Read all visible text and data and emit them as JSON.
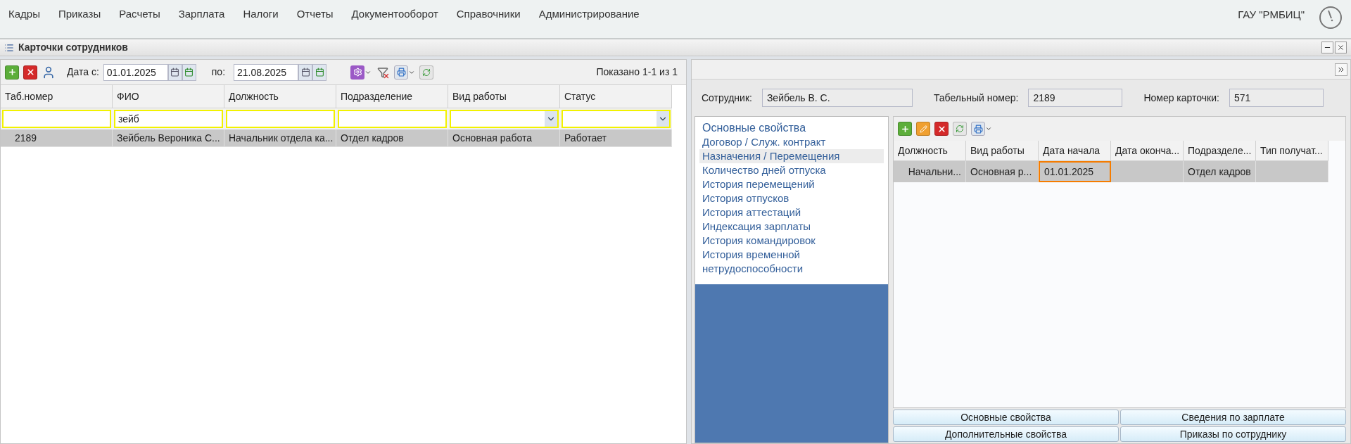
{
  "menu": {
    "items": [
      "Кадры",
      "Приказы",
      "Расчеты",
      "Зарплата",
      "Налоги",
      "Отчеты",
      "Документооборот",
      "Справочники",
      "Администрирование"
    ],
    "org": "ГАУ \"РМБИЦ\""
  },
  "window": {
    "title": "Карточки сотрудников"
  },
  "toolbar": {
    "date_from_label": "Дата с:",
    "date_from": "01.01.2025",
    "date_to_label": "по:",
    "date_to": "21.08.2025",
    "shown": "Показано 1-1 из 1"
  },
  "table": {
    "columns": [
      {
        "label": "Таб.номер",
        "filter": {
          "kind": "text"
        }
      },
      {
        "label": "ФИО",
        "filter": {
          "kind": "text",
          "value": "зейб"
        }
      },
      {
        "label": "Должность",
        "filter": {
          "kind": "text"
        }
      },
      {
        "label": "Подразделение",
        "filter": {
          "kind": "text"
        }
      },
      {
        "label": "Вид работы",
        "filter": {
          "kind": "select"
        }
      },
      {
        "label": "Статус",
        "filter": {
          "kind": "select"
        }
      }
    ],
    "rows": [
      {
        "selected": true,
        "cells": [
          "2189",
          "Зейбель Вероника С...",
          "Начальник отдела ка...",
          "Отдел кадров",
          "Основная работа",
          "Работает"
        ]
      }
    ]
  },
  "details": {
    "fields": [
      {
        "label": "Сотрудник:",
        "value": "Зейбель В. С."
      },
      {
        "label": "Табельный номер:",
        "value": "2189"
      },
      {
        "label": "Номер карточки:",
        "value": "571"
      }
    ],
    "nav": [
      {
        "label": "Основные свойства",
        "selected": false
      },
      {
        "label": "Договор / Служ. контракт",
        "selected": false
      },
      {
        "label": "Назначения / Перемещения",
        "selected": true
      },
      {
        "label": "Количество дней отпуска",
        "selected": false
      },
      {
        "label": "История перемещений",
        "selected": false
      },
      {
        "label": "История отпусков",
        "selected": false
      },
      {
        "label": "История аттестаций",
        "selected": false
      },
      {
        "label": "Индексация зарплаты",
        "selected": false
      },
      {
        "label": "История командировок",
        "selected": false
      },
      {
        "label": "История временной нетрудоспособности",
        "selected": false
      }
    ],
    "grid": {
      "columns": [
        "Должность",
        "Вид работы",
        "Дата начала",
        "Дата оконча...",
        "Подразделе...",
        "Тип получат..."
      ],
      "rows": [
        {
          "selected": true,
          "cells": [
            {
              "text": "Начальни...",
              "highlighted": false
            },
            {
              "text": "Основная р...",
              "highlighted": false
            },
            {
              "text": "01.01.2025",
              "highlighted": true
            },
            {
              "highlighted": false
            },
            {
              "text": "Отдел кадров",
              "highlighted": false
            },
            {
              "highlighted": false
            }
          ]
        }
      ]
    },
    "buttons": [
      "Основные свойства",
      "Сведения по зарплате",
      "Дополнительные свойства",
      "Приказы по сотруднику"
    ]
  }
}
